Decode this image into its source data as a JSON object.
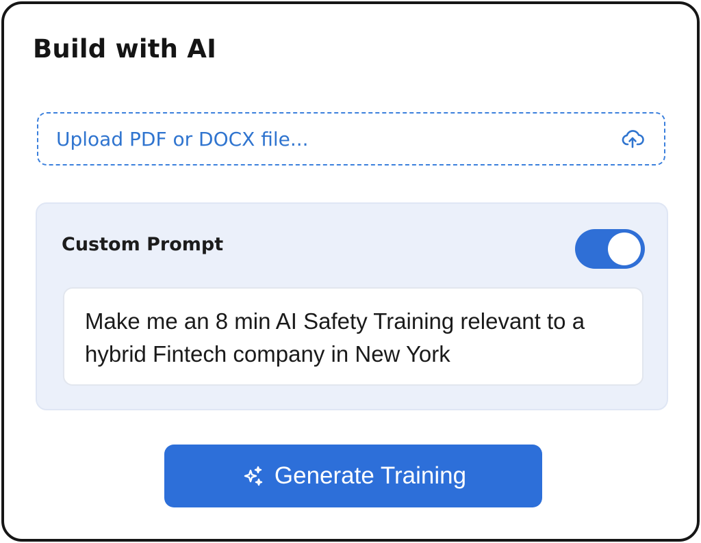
{
  "card": {
    "title": "Build with AI"
  },
  "upload": {
    "label": "Upload PDF or DOCX file...",
    "icon": "cloud-upload-icon"
  },
  "custom_prompt": {
    "label": "Custom Prompt",
    "toggle_on": true,
    "value": "Make me an 8 min AI Safety Training relevant to a hybrid Fintech company in New York"
  },
  "generate": {
    "label": "Generate Training",
    "icon": "sparkles-icon"
  },
  "colors": {
    "accent": "#2d6fd9",
    "upload_text": "#2f74cf",
    "panel_bg": "#ebf0fa",
    "card_border": "#161616"
  }
}
